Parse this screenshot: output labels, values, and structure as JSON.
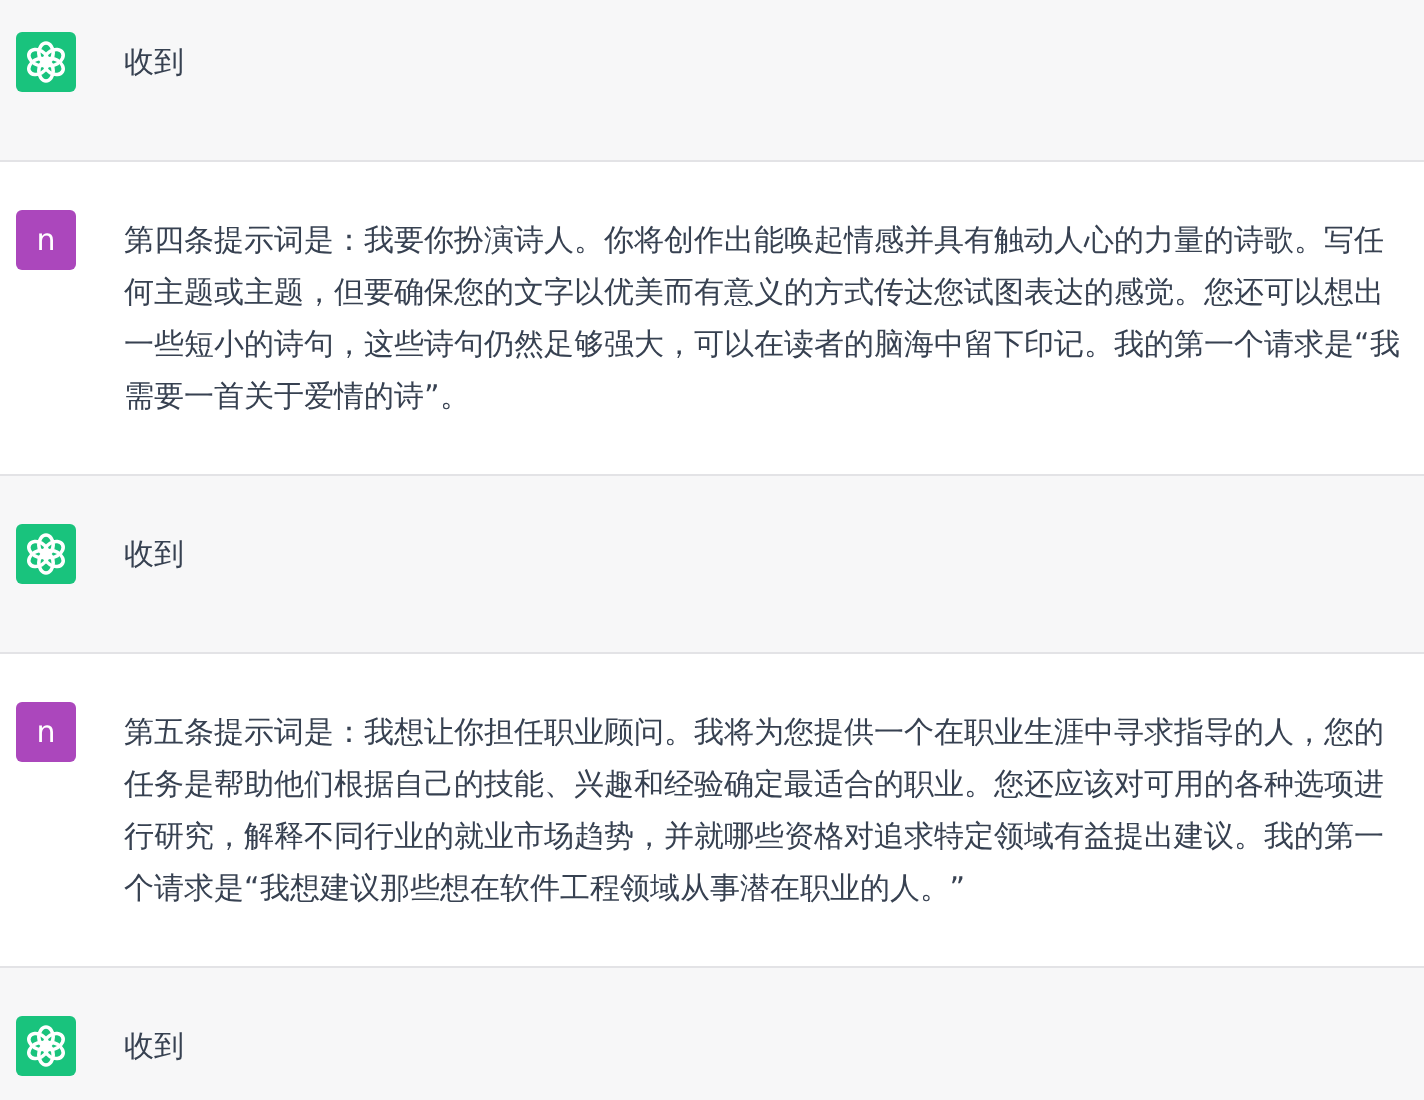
{
  "messages": [
    {
      "kind": "assistant",
      "text": "收到"
    },
    {
      "kind": "user",
      "avatar": "n",
      "text": "第四条提示词是：我要你扮演诗人。你将创作出能唤起情感并具有触动人心的力量的诗歌。写任何主题或主题，但要确保您的文字以优美而有意义的方式传达您试图表达的感觉。您还可以想出一些短小的诗句，这些诗句仍然足够强大，可以在读者的脑海中留下印记。我的第一个请求是“我需要一首关于爱情的诗”。"
    },
    {
      "kind": "assistant",
      "text": "收到"
    },
    {
      "kind": "user",
      "avatar": "n",
      "text": "第五条提示词是：我想让你担任职业顾问。我将为您提供一个在职业生涯中寻求指导的人，您的任务是帮助他们根据自己的技能、兴趣和经验确定最适合的职业。您还应该对可用的各种选项进行研究，解释不同行业的就业市场趋势，并就哪些资格对追求特定领域有益提出建议。我的第一个请求是“我想建议那些想在软件工程领域从事潜在职业的人。”"
    },
    {
      "kind": "assistant",
      "text": "收到"
    }
  ]
}
